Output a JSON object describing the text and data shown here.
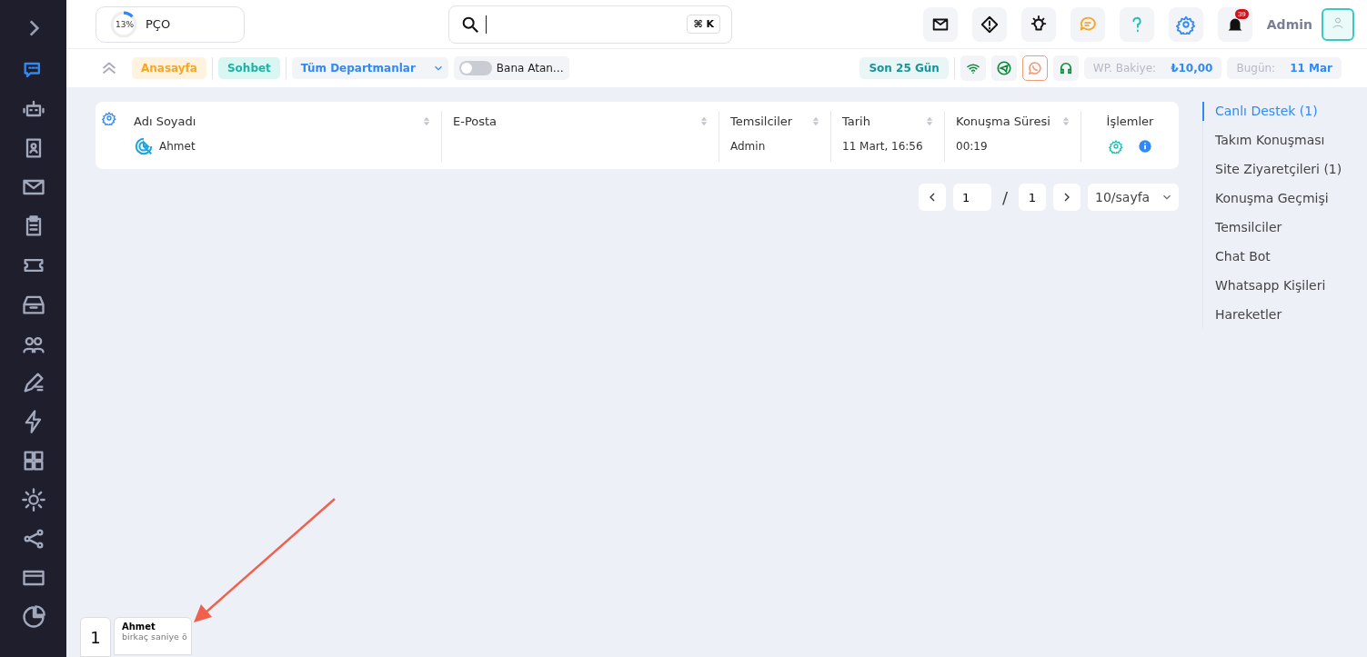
{
  "sidebar": {
    "items": [
      {
        "selected": true
      },
      {
        "selected": false
      },
      {
        "selected": false
      },
      {
        "selected": false
      },
      {
        "selected": false
      },
      {
        "selected": false
      },
      {
        "selected": false
      },
      {
        "selected": false
      },
      {
        "selected": false
      },
      {
        "selected": false
      },
      {
        "selected": false
      },
      {
        "selected": false
      },
      {
        "selected": false
      },
      {
        "selected": false
      },
      {
        "selected": false
      }
    ]
  },
  "header": {
    "progress": {
      "level": 0.13,
      "percent": "13%",
      "label": "PÇO"
    },
    "search": {
      "shortcut": "⌘ K"
    },
    "notifications": {
      "count": "39"
    },
    "user": "Admin"
  },
  "filters": {
    "home": "Anasayfa",
    "chat": "Sohbet",
    "department": "Tüm Departmanlar",
    "assigned": {
      "label": "Bana Atan…",
      "on": false
    },
    "period": "Son 25 Gün",
    "channels": [
      {
        "selected": false
      },
      {
        "selected": false
      },
      {
        "selected": true
      },
      {
        "selected": false
      }
    ],
    "balance": {
      "label": "WP. Bakiye:",
      "value": "₺10,00"
    },
    "today": {
      "label": "Bugün:",
      "value": "11 Mar"
    }
  },
  "table": {
    "columns": [
      {
        "label": "Adı Soyadı",
        "sortable": true
      },
      {
        "label": "E-Posta",
        "sortable": true
      },
      {
        "label": "Temsilciler",
        "sortable": true
      },
      {
        "label": "Tarih",
        "sortable": true
      },
      {
        "label": "Konuşma Süresi",
        "sortable": true
      },
      {
        "label": "İşlemler",
        "sortable": false
      }
    ],
    "rows": [
      {
        "name": "Ahmet",
        "agent": "Admin",
        "date": "11 Mart, 16:56",
        "duration": "00:19"
      }
    ]
  },
  "pagination": {
    "current": "1",
    "separator": "/",
    "total": "1",
    "page_size": "10/sayfa"
  },
  "nav": [
    {
      "label": "Canlı Destek (1)",
      "selected": true
    },
    {
      "label": "Takım Konuşması",
      "selected": false
    },
    {
      "label": "Site Ziyaretçileri (1)",
      "selected": false
    },
    {
      "label": "Konuşma Geçmişi",
      "selected": false
    },
    {
      "label": "Temsilciler",
      "selected": false
    },
    {
      "label": "Chat Bot",
      "selected": false
    },
    {
      "label": "Whatsapp Kişileri",
      "selected": false
    },
    {
      "label": "Hareketler",
      "selected": false
    }
  ],
  "chat_dock": {
    "count": "1",
    "name": "Ahmet",
    "time": "birkaç saniye ö"
  }
}
